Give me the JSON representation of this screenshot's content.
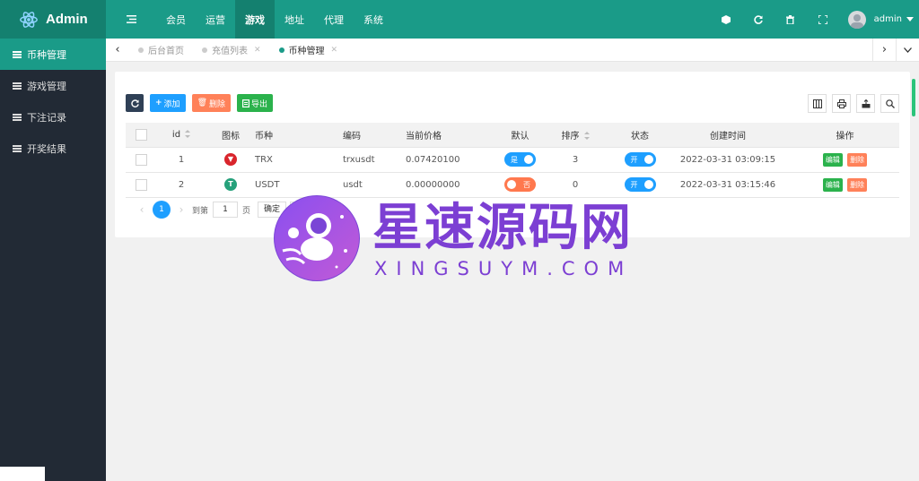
{
  "app": {
    "title": "Admin"
  },
  "header": {
    "nav": [
      {
        "label": "会员",
        "active": false
      },
      {
        "label": "运营",
        "active": false
      },
      {
        "label": "游戏",
        "active": true
      },
      {
        "label": "地址",
        "active": false
      },
      {
        "label": "代理",
        "active": false
      },
      {
        "label": "系统",
        "active": false
      }
    ],
    "user_name": "admin",
    "icons": [
      "cube-icon",
      "refresh-icon",
      "trash-icon",
      "fullscreen-icon"
    ]
  },
  "sidebar": {
    "items": [
      {
        "label": "币种管理",
        "active": true
      },
      {
        "label": "游戏管理",
        "active": false
      },
      {
        "label": "下注记录",
        "active": false
      },
      {
        "label": "开奖结果",
        "active": false
      }
    ]
  },
  "tabs": [
    {
      "label": "后台首页",
      "active": false,
      "closable": false
    },
    {
      "label": "充值列表",
      "active": false,
      "closable": true
    },
    {
      "label": "币种管理",
      "active": true,
      "closable": true
    }
  ],
  "toolbar": {
    "add_label": "添加",
    "delete_label": "删除",
    "export_label": "导出"
  },
  "table": {
    "headers": [
      "id",
      "图标",
      "币种",
      "编码",
      "当前价格",
      "默认",
      "排序",
      "状态",
      "创建时间",
      "操作"
    ],
    "rows": [
      {
        "id": "1",
        "icon": "trx-icon",
        "icon_color": "#d9252c",
        "coin": "TRX",
        "code": "trxusdt",
        "price": "0.07420100",
        "default_label": "是",
        "default_on": true,
        "sort": "3",
        "status_label": "开",
        "status_on": true,
        "created": "2022-03-31 03:09:15",
        "edit_label": "编辑",
        "del_label": "删除"
      },
      {
        "id": "2",
        "icon": "usdt-icon",
        "icon_color": "#26a17b",
        "coin": "USDT",
        "code": "usdt",
        "price": "0.00000000",
        "default_label": "否",
        "default_on": false,
        "sort": "0",
        "status_label": "开",
        "status_on": true,
        "created": "2022-03-31 03:15:46",
        "edit_label": "编辑",
        "del_label": "删除"
      }
    ]
  },
  "pager": {
    "current_page": "1",
    "goto_label": "到第",
    "page_input": "1",
    "page_unit": "页",
    "confirm_label": "确定"
  },
  "watermark": {
    "title": "星速源码网",
    "subtitle": "XINGSUYM.COM"
  },
  "colors": {
    "header": "#1a9b88",
    "header_active": "#14806f",
    "sidebar": "#222a35",
    "primary": "#1e9fff",
    "danger": "#ff5722",
    "success": "#2bb24c",
    "watermark": "#7c3fd3"
  }
}
